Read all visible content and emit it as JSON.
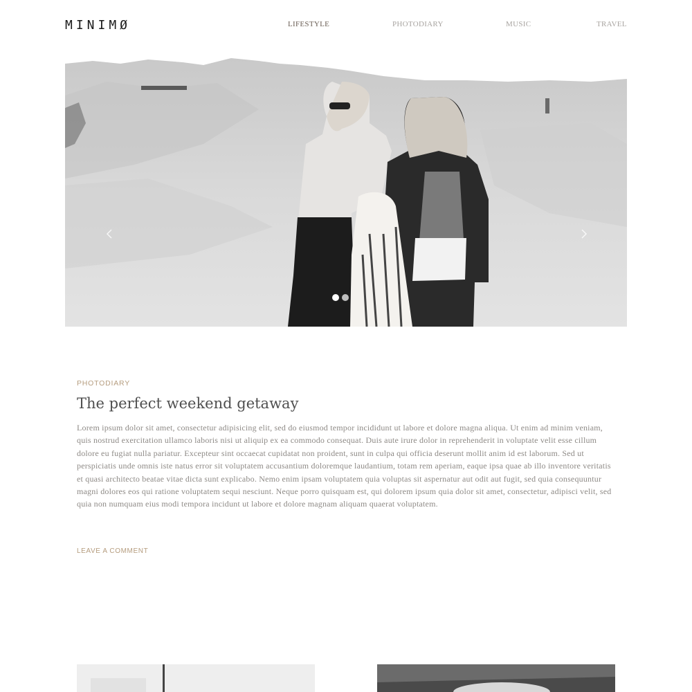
{
  "header": {
    "logo": "MINIMØ",
    "nav": [
      "LIFESTYLE",
      "PHOTODIARY",
      "MUSIC",
      "TRAVEL"
    ],
    "active_nav": "LIFESTYLE"
  },
  "hero": {
    "slides_total": 2,
    "active_slide": 1
  },
  "post": {
    "category": "PHOTODIARY",
    "title": "The perfect weekend getaway",
    "body": "Lorem ipsum dolor sit amet, consectetur adipisicing elit, sed do eiusmod tempor incididunt ut labore et dolore magna aliqua. Ut enim ad minim veniam, quis nostrud exercitation ullamco laboris nisi ut aliquip ex ea commodo consequat. Duis aute irure dolor in reprehenderit in voluptate velit esse cillum dolore eu fugiat nulla pariatur. Excepteur sint occaecat cupidatat non proident, sunt in culpa qui officia deserunt mollit anim id est laborum. Sed ut perspiciatis unde omnis iste natus error sit voluptatem accusantium doloremque laudantium, totam rem aperiam, eaque ipsa quae ab illo inventore veritatis et quasi architecto beatae vitae dicta sunt explicabo. Nemo enim ipsam voluptatem quia voluptas sit aspernatur aut odit aut fugit, sed quia consequuntur magni dolores eos qui ratione voluptatem sequi nesciunt. Neque porro quisquam est, qui dolorem ipsum quia dolor sit amet, consectetur, adipisci velit, sed quia non numquam eius modi tempora incidunt ut labore et dolore magnam aliquam quaerat voluptatem.",
    "comment_link": "LEAVE A COMMENT"
  },
  "colors": {
    "accent": "#b59c7e",
    "text": "#8e8a86",
    "heading": "#4f4f4f"
  }
}
